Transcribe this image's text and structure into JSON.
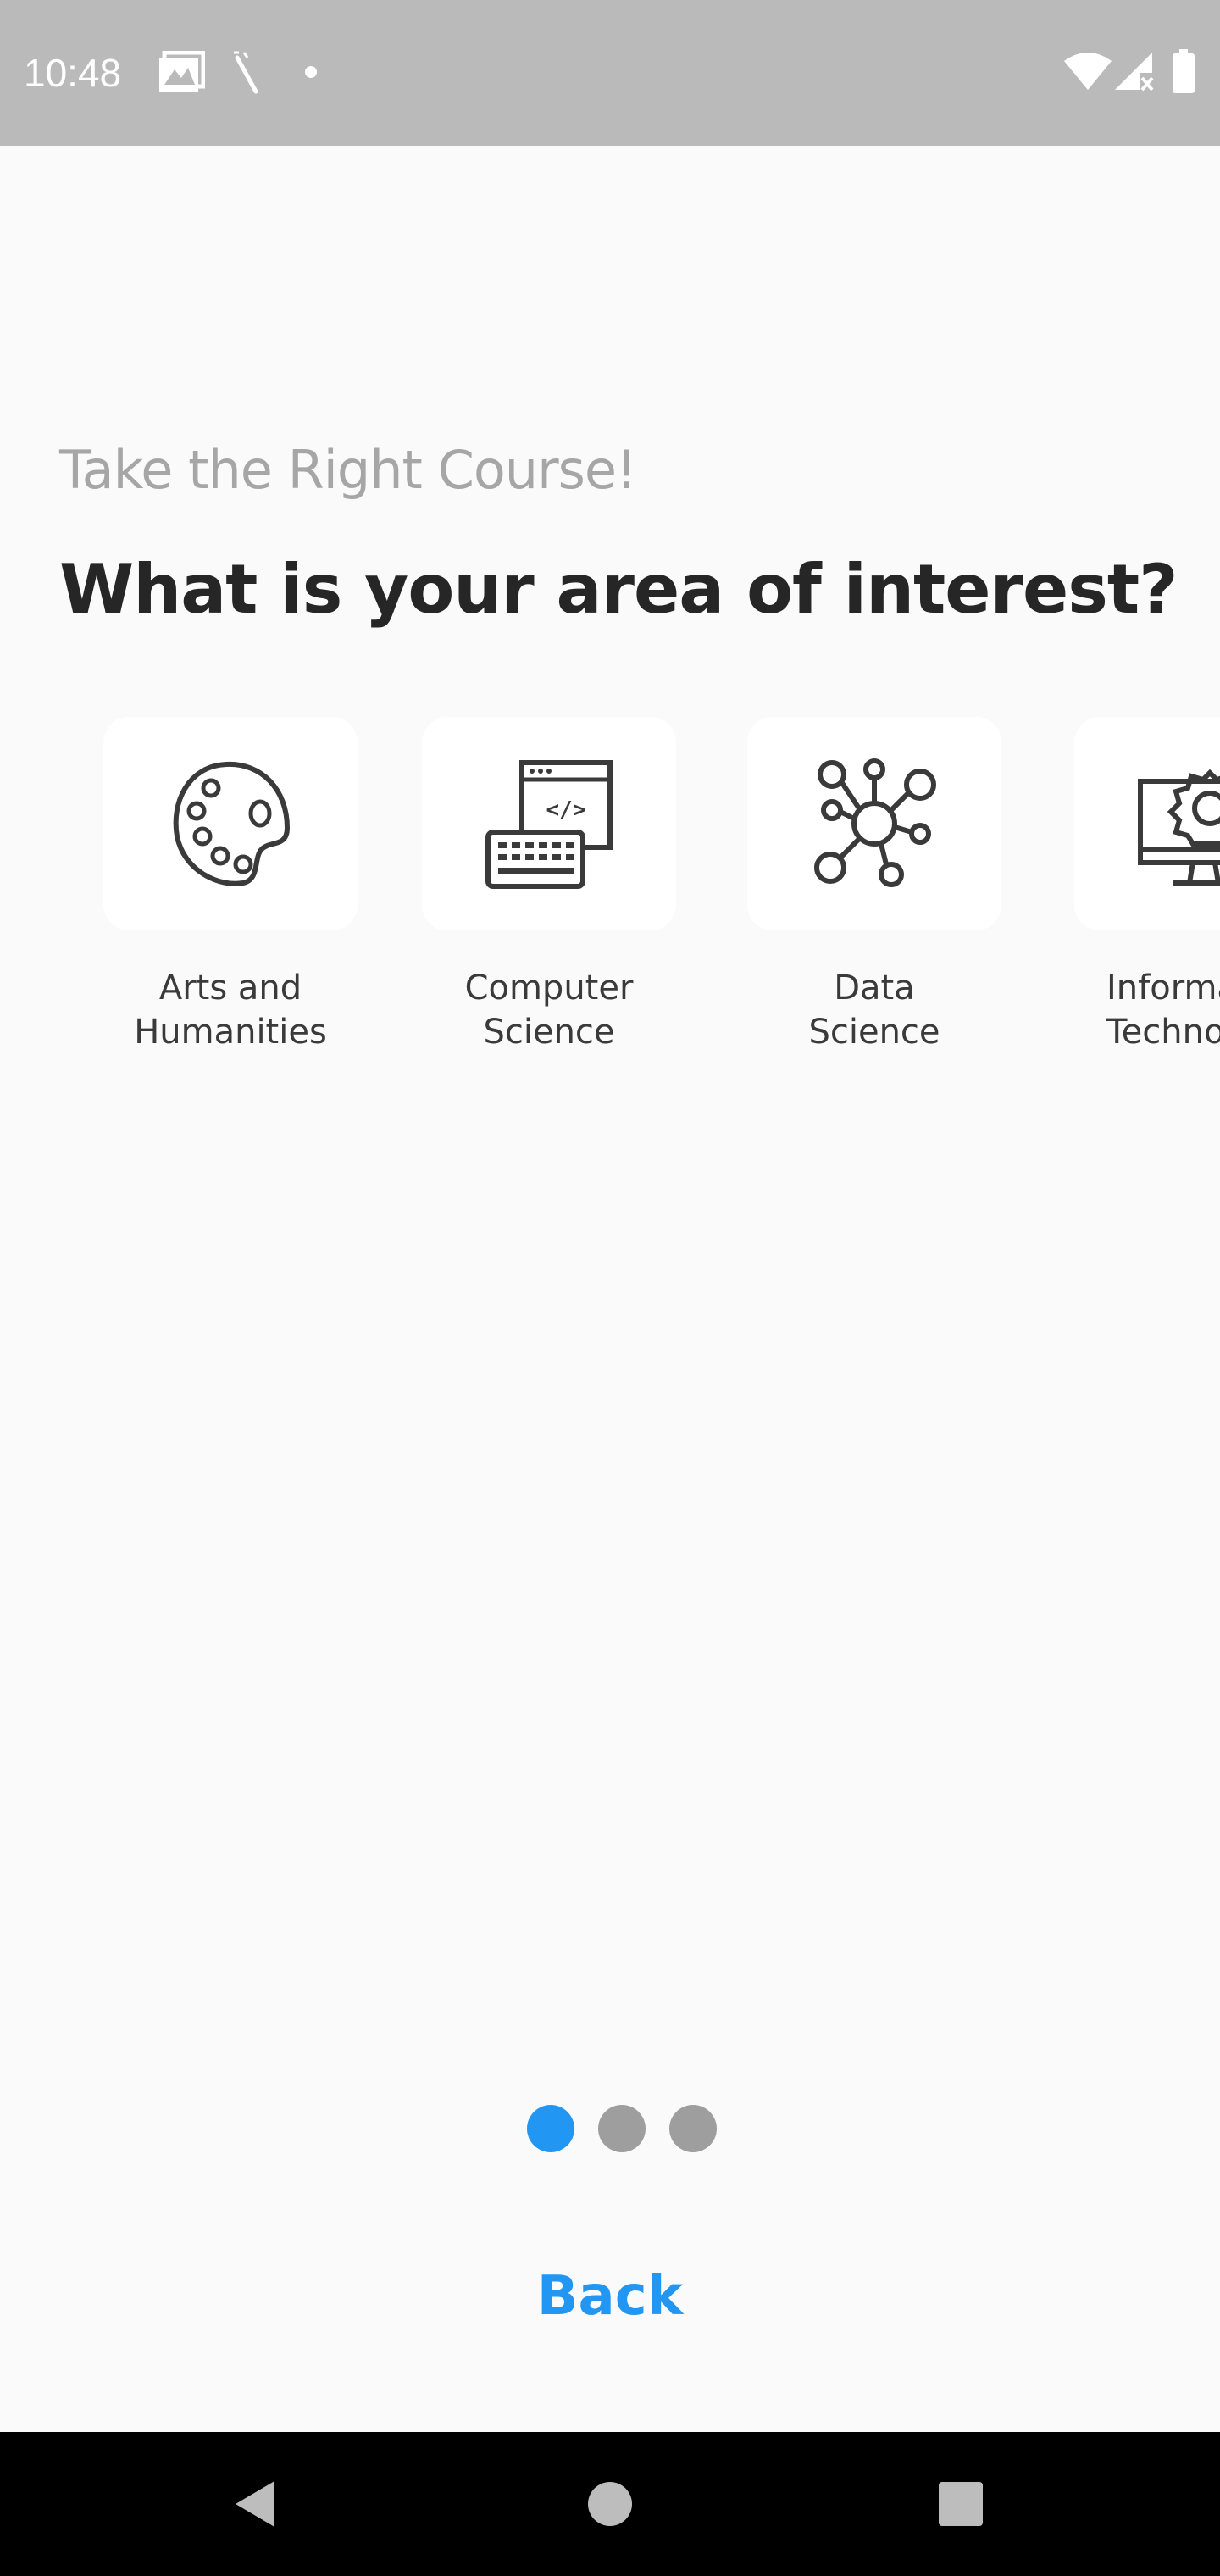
{
  "status_bar": {
    "time": "10:48",
    "icons": [
      "gallery-icon",
      "wand-icon",
      "notification-dot-icon",
      "wifi-icon",
      "signal-icon",
      "battery-icon"
    ]
  },
  "header": {
    "subtitle": "Take the Right Course!",
    "title": "What is your area of interest?"
  },
  "categories": [
    {
      "label": "Arts and\nHumanities",
      "icon": "palette-icon"
    },
    {
      "label": "Computer\nScience",
      "icon": "code-keyboard-icon"
    },
    {
      "label": "Data\nScience",
      "icon": "network-nodes-icon"
    },
    {
      "label": "Informa\nTechno",
      "icon": "monitor-gear-icon"
    }
  ],
  "pager": {
    "count": 3,
    "active_index": 0,
    "active_color": "#2196f3",
    "inactive_color": "#9e9e9e"
  },
  "footer": {
    "back_label": "Back"
  },
  "nav_bar": {
    "icons": [
      "back-triangle-icon",
      "home-circle-icon",
      "recents-square-icon"
    ]
  },
  "colors": {
    "accent": "#2196f3",
    "background": "#fafafa",
    "status_bar": "#bababa",
    "title": "#262626",
    "subtitle": "#a6a6a6"
  }
}
